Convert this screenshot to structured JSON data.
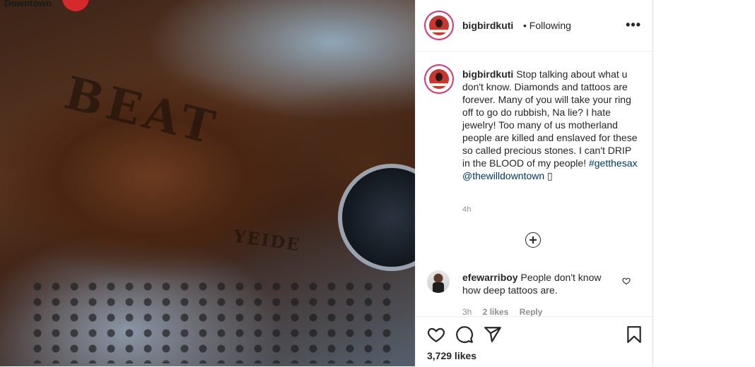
{
  "photo": {
    "watermark": "Downtown",
    "tattoo_knuckles": "BEAT",
    "tattoo_wrist": "YEIDE"
  },
  "post": {
    "username": "bigbirdkuti",
    "follow_status": "• Following",
    "more_label": "•••",
    "caption_user": "bigbirdkuti",
    "caption_text": "Stop talking about what u don't know. Diamonds and tattoos are forever. Many of you will take your ring off to go do rubbish, Na lie? I hate jewelry! Too many of us motherland people are killed and enslaved for these so called precious stones. I can't DRIP in the BLOOD of my people!",
    "hashtag": "#getthesax",
    "mention": "@thewilldowntown",
    "trailing_glyph": "▯",
    "time": "4h"
  },
  "comment": {
    "username": "efewarriboy",
    "text": "People don't know how deep tattoos are.",
    "time": "3h",
    "likes": "2 likes",
    "reply": "Reply"
  },
  "footer": {
    "likes": "3,729 likes"
  },
  "icons": {
    "like": "heart-icon",
    "comment": "comment-icon",
    "share": "share-icon",
    "save": "bookmark-icon",
    "load_more": "plus-circle-icon",
    "comment_like": "heart-icon"
  }
}
